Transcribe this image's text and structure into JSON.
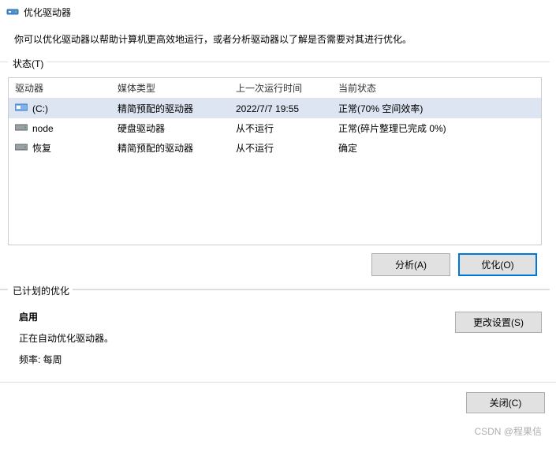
{
  "window": {
    "title": "优化驱动器",
    "description": "你可以优化驱动器以帮助计算机更高效地运行，或者分析驱动器以了解是否需要对其进行优化。"
  },
  "status": {
    "group_label": "状态(T)",
    "headers": {
      "drive": "驱动器",
      "media": "媒体类型",
      "last": "上一次运行时间",
      "current": "当前状态"
    },
    "rows": [
      {
        "icon": "drive-c",
        "drive": "(C:)",
        "media": "精简预配的驱动器",
        "last": "2022/7/7 19:55",
        "current": "正常(70% 空间效率)",
        "selected": true
      },
      {
        "icon": "drive-hdd",
        "drive": "node",
        "media": "硬盘驱动器",
        "last": "从不运行",
        "current": "正常(碎片整理已完成 0%)",
        "selected": false
      },
      {
        "icon": "drive-hdd",
        "drive": "恢复",
        "media": "精简预配的驱动器",
        "last": "从不运行",
        "current": "确定",
        "selected": false
      }
    ],
    "analyze_button": "分析(A)",
    "optimize_button": "优化(O)"
  },
  "schedule": {
    "group_label": "已计划的优化",
    "enabled_label": "启用",
    "desc": "正在自动优化驱动器。",
    "frequency": "频率: 每周",
    "change_button": "更改设置(S)"
  },
  "footer": {
    "close_button": "关闭(C)"
  },
  "watermark": "CSDN @程果信"
}
